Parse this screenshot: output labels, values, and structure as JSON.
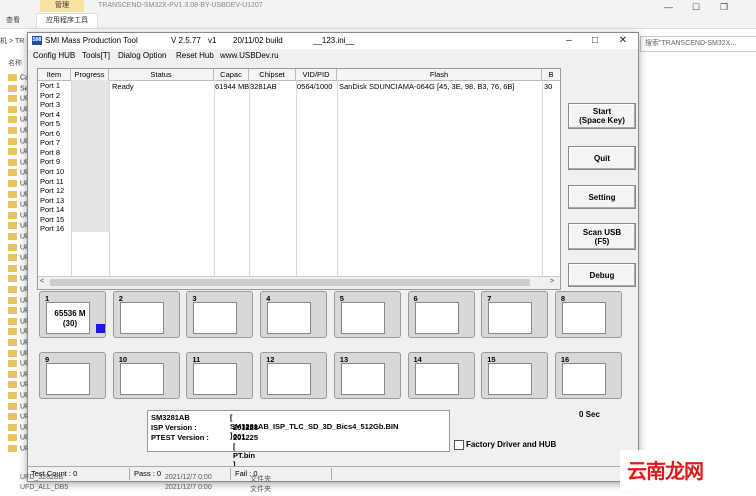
{
  "explorer": {
    "tab_manage": "管理",
    "tab_view": "查看",
    "tab_app_tools": "应用程序工具",
    "title": "TRANSCEND-SM32X-PV1.3.08-BY-USBDEV-U1207",
    "path_prefix": "机  >  TR",
    "search_placeholder": "搜索\"TRANSCEND-SM32X...",
    "name_header": "名称",
    "sidebar_rows": [
      "Ca",
      "Se",
      "UF",
      "UF",
      "UF",
      "UF",
      "UF",
      "UF",
      "UF",
      "UF",
      "UF",
      "UF",
      "UF",
      "UF",
      "UF",
      "UF",
      "UF",
      "UF",
      "UF",
      "UF",
      "UF",
      "UF",
      "UF",
      "UF",
      "UF",
      "UF",
      "UF",
      "UF",
      "UF",
      "UF",
      "UF",
      "UF",
      "UF",
      "UF",
      "UF",
      "UF"
    ],
    "bottom_rows": [
      {
        "name": "UFD_3282BB",
        "date": "2021/12/7 0:00",
        "type": "文件夹"
      },
      {
        "name": "UFD_ALL_DB5",
        "date": "2021/12/7 0:00",
        "type": "文件夹"
      }
    ]
  },
  "app": {
    "icon_text": "SMI",
    "title": "SMI Mass Production Tool",
    "version": "V 2.5.77",
    "v1": "v1",
    "build": "20/11/02 build",
    "ini": "__123.ini__",
    "menu": [
      "Config HUB",
      "Tools[T]",
      "Dialog Option",
      "Reset Hub",
      "www.USBDev.ru"
    ],
    "table": {
      "headers": [
        "Item",
        "Progress",
        "Status",
        "Capac",
        "Chipset",
        "VID/PID",
        "Flash",
        "B"
      ],
      "ports": [
        "Port 1",
        "Port 2",
        "Port 3",
        "Port 4",
        "Port 5",
        "Port 6",
        "Port 7",
        "Port 8",
        "Port 9",
        "Port 10",
        "Port 11",
        "Port 12",
        "Port 13",
        "Port 14",
        "Port 15",
        "Port 16"
      ],
      "row1": {
        "status": "Ready",
        "capacity": "61944 MB",
        "chipset": "3281AB",
        "vidpid": "0564/1000",
        "flash": "SanDisk SDUNCIAMA-064G [45, 3E, 98, B3, 76, 6B]",
        "b": "30"
      }
    },
    "buttons": {
      "start_line1": "Start",
      "start_line2": "(Space Key)",
      "quit": "Quit",
      "setting": "Setting",
      "scan_line1": "Scan USB",
      "scan_line2": "(F5)",
      "debug": "Debug"
    },
    "port_boxes": [
      "1",
      "2",
      "3",
      "4",
      "5",
      "6",
      "7",
      "8",
      "9",
      "10",
      "11",
      "12",
      "13",
      "14",
      "15",
      "16"
    ],
    "port1_capacity": "65536 M",
    "port1_sub": "(30)",
    "info": {
      "chip_label": "SM3281AB",
      "chip_value": "[ SM3281AB_ISP_TLC_SD_3D_Bics4_512Gb.BIN ]",
      "isp_label": "ISP Version :",
      "isp_value": "201228-001",
      "ptest_label": "PTEST Version :",
      "ptest_value": "201225 [ PT.bin ]"
    },
    "timer": "0 Sec",
    "factory_label": "Factory Driver and HUB",
    "status_bar": {
      "test_count": "Test Count : 0",
      "pass": "Pass : 0",
      "fail": "Fail : 0"
    }
  },
  "watermark": "云南龙网"
}
